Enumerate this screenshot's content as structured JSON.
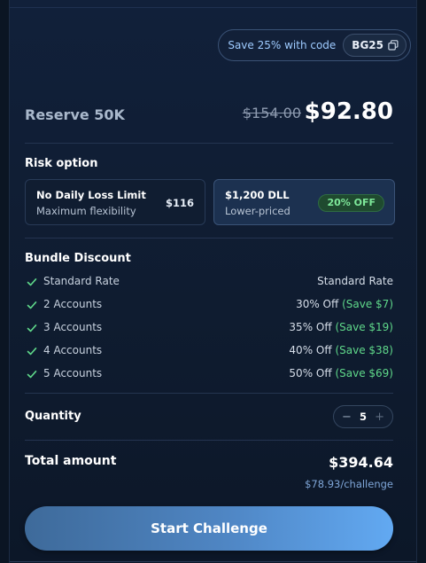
{
  "promo": {
    "text": "Save 25% with code",
    "code": "BG25"
  },
  "product": {
    "title": "Reserve 50K",
    "old_price": "$154.00",
    "new_price": "$92.80"
  },
  "risk": {
    "label": "Risk option",
    "options": [
      {
        "title": "No Daily Loss Limit",
        "subtitle": "Maximum flexibility",
        "price": "$116",
        "selected": false
      },
      {
        "title": "$1,200 DLL",
        "subtitle": "Lower-priced",
        "badge": "20% OFF",
        "selected": true
      }
    ]
  },
  "bundle": {
    "label": "Bundle Discount",
    "rows": [
      {
        "label": "Standard Rate",
        "discount": "Standard Rate",
        "save": ""
      },
      {
        "label": "2 Accounts",
        "discount": "30% Off",
        "save": "(Save $7)"
      },
      {
        "label": "3 Accounts",
        "discount": "35% Off",
        "save": "(Save $19)"
      },
      {
        "label": "4 Accounts",
        "discount": "40% Off",
        "save": "(Save $38)"
      },
      {
        "label": "5 Accounts",
        "discount": "50% Off",
        "save": "(Save $69)"
      }
    ]
  },
  "quantity": {
    "label": "Quantity",
    "minus": "−",
    "value": "5",
    "plus": "+"
  },
  "total": {
    "label": "Total amount",
    "amount": "$394.64",
    "per": "$78.93/challenge"
  },
  "cta": {
    "label": "Start Challenge"
  },
  "colors": {
    "accent": "#62a9f2",
    "save_green": "#5fd88a",
    "background": "#0b1523"
  }
}
